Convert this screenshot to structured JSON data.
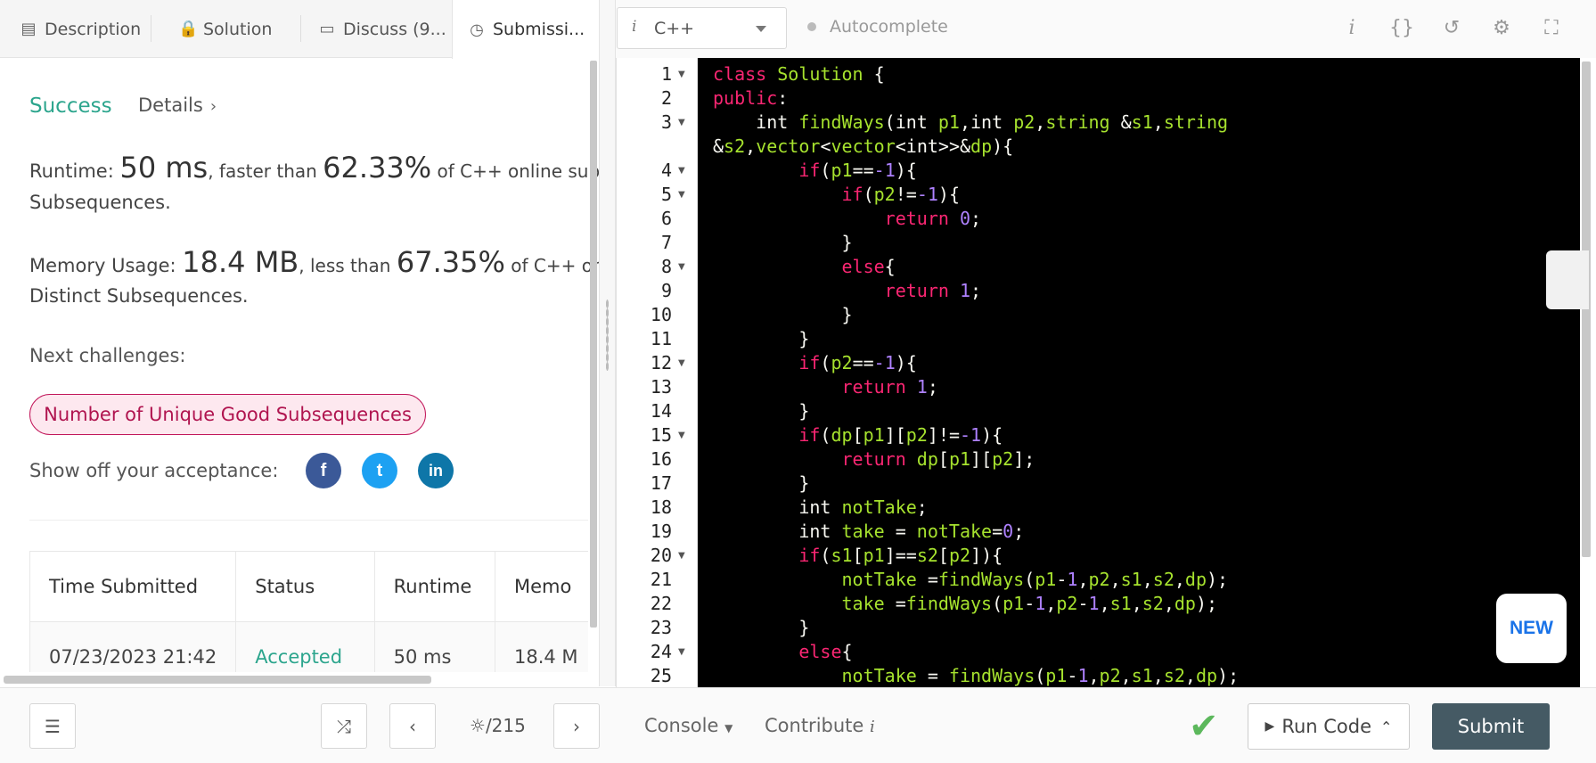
{
  "tabs": [
    {
      "label": "Description",
      "icon": "description-icon"
    },
    {
      "label": "Solution",
      "icon": "lock-icon"
    },
    {
      "label": "Discuss (9...",
      "icon": "comment-icon"
    },
    {
      "label": "Submissi...",
      "icon": "clock-icon"
    }
  ],
  "result": {
    "status": "Success",
    "details_label": "Details",
    "runtime_label": "Runtime: ",
    "runtime_value": "50 ms",
    "runtime_mid": ", faster than ",
    "runtime_pct": "62.33%",
    "runtime_tail": " of C++ online subm",
    "runtime_line2": "Subsequences.",
    "memory_label": "Memory Usage: ",
    "memory_value": "18.4 MB",
    "memory_mid": ", less than ",
    "memory_pct": "67.35%",
    "memory_tail": " of C++ onlin",
    "memory_line2": "Distinct Subsequences.",
    "next_label": "Next challenges:",
    "next_challenge": "Number of Unique Good Subsequences",
    "show_off": "Show off your acceptance:"
  },
  "social": [
    {
      "name": "facebook-icon",
      "glyph": "f",
      "color": "#3b5998"
    },
    {
      "name": "twitter-icon",
      "glyph": "t",
      "color": "#1da1f2"
    },
    {
      "name": "linkedin-icon",
      "glyph": "in",
      "color": "#0e76a8"
    }
  ],
  "table": {
    "headers": [
      "Time Submitted",
      "Status",
      "Runtime",
      "Memo"
    ],
    "rows": [
      [
        "07/23/2023 21:42",
        "Accepted",
        "50 ms",
        "18.4 M"
      ]
    ]
  },
  "toolbar": {
    "language": "C++",
    "autocomplete": "Autocomplete"
  },
  "code": {
    "lines": [
      {
        "n": "1",
        "fold": true,
        "html": "<span class='kw'>class</span> <span class='tp'>Solution</span> {"
      },
      {
        "n": "2",
        "fold": false,
        "html": "<span class='kw'>public</span>:"
      },
      {
        "n": "3",
        "fold": true,
        "html": "    int <span class='fn'>findWays</span>(int <span class='vr'>p1</span>,int <span class='vr'>p2</span>,<span class='tp'>string</span> &amp;<span class='vr'>s1</span>,<span class='tp'>string</span>"
      },
      {
        "n": "",
        "fold": false,
        "html": "&amp;<span class='vr'>s2</span>,<span class='tp'>vector</span>&lt;<span class='tp'>vector</span>&lt;int&gt;&gt;&amp;<span class='vr'>dp</span>){"
      },
      {
        "n": "4",
        "fold": true,
        "html": "        <span class='kw'>if</span>(<span class='vr'>p1</span>==<span class='nm'>-1</span>){"
      },
      {
        "n": "5",
        "fold": true,
        "html": "            <span class='kw'>if</span>(<span class='vr'>p2</span>!=<span class='nm'>-1</span>){"
      },
      {
        "n": "6",
        "fold": false,
        "html": "                <span class='kw'>return</span> <span class='nm'>0</span>;"
      },
      {
        "n": "7",
        "fold": false,
        "html": "            }"
      },
      {
        "n": "8",
        "fold": true,
        "html": "            <span class='kw'>else</span>{"
      },
      {
        "n": "9",
        "fold": false,
        "html": "                <span class='kw'>return</span> <span class='nm'>1</span>;"
      },
      {
        "n": "10",
        "fold": false,
        "html": "            }"
      },
      {
        "n": "11",
        "fold": false,
        "html": "        }"
      },
      {
        "n": "12",
        "fold": true,
        "html": "        <span class='kw'>if</span>(<span class='vr'>p2</span>==<span class='nm'>-1</span>){"
      },
      {
        "n": "13",
        "fold": false,
        "html": "            <span class='kw'>return</span> <span class='nm'>1</span>;"
      },
      {
        "n": "14",
        "fold": false,
        "html": "        }"
      },
      {
        "n": "15",
        "fold": true,
        "html": "        <span class='kw'>if</span>(<span class='vr'>dp</span>[<span class='vr'>p1</span>][<span class='vr'>p2</span>]!=<span class='nm'>-1</span>){"
      },
      {
        "n": "16",
        "fold": false,
        "html": "            <span class='kw'>return</span> <span class='vr'>dp</span>[<span class='vr'>p1</span>][<span class='vr'>p2</span>];"
      },
      {
        "n": "17",
        "fold": false,
        "html": "        }"
      },
      {
        "n": "18",
        "fold": false,
        "html": "        int <span class='vr'>notTake</span>;"
      },
      {
        "n": "19",
        "fold": false,
        "html": "        int <span class='vr'>take</span> = <span class='vr'>notTake</span>=<span class='nm'>0</span>;"
      },
      {
        "n": "20",
        "fold": true,
        "html": "        <span class='kw'>if</span>(<span class='vr'>s1</span>[<span class='vr'>p1</span>]==<span class='vr'>s2</span>[<span class='vr'>p2</span>]){"
      },
      {
        "n": "21",
        "fold": false,
        "html": "            <span class='vr'>notTake</span> =<span class='fn'>findWays</span>(<span class='vr'>p1</span>-<span class='nm'>1</span>,<span class='vr'>p2</span>,<span class='vr'>s1</span>,<span class='vr'>s2</span>,<span class='vr'>dp</span>);"
      },
      {
        "n": "22",
        "fold": false,
        "html": "            <span class='vr'>take</span> =<span class='fn'>findWays</span>(<span class='vr'>p1</span>-<span class='nm'>1</span>,<span class='vr'>p2</span>-<span class='nm'>1</span>,<span class='vr'>s1</span>,<span class='vr'>s2</span>,<span class='vr'>dp</span>);"
      },
      {
        "n": "23",
        "fold": false,
        "html": "        }"
      },
      {
        "n": "24",
        "fold": true,
        "html": "        <span class='kw'>else</span>{"
      },
      {
        "n": "25",
        "fold": false,
        "html": "            <span class='vr'>notTake</span> = <span class='fn'>findWays</span>(<span class='vr'>p1</span>-<span class='nm'>1</span>,<span class='vr'>p2</span>,<span class='vr'>s1</span>,<span class='vr'>s2</span>,<span class='vr'>dp</span>);"
      }
    ]
  },
  "badge": "NEW",
  "bottom": {
    "page": "/215",
    "console": "Console",
    "contribute": "Contribute",
    "run": "Run Code",
    "submit": "Submit"
  }
}
